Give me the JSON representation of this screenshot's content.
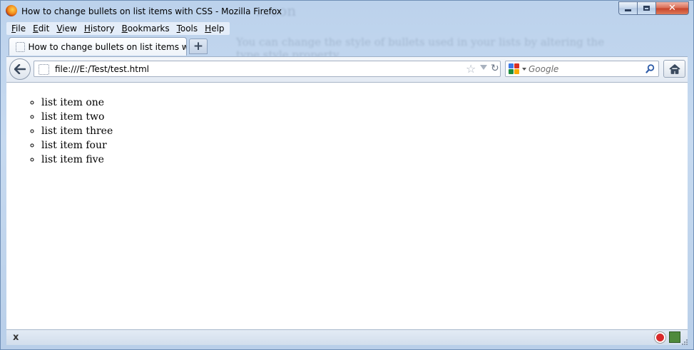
{
  "window": {
    "title": "How to change bullets on list items with CSS - Mozilla Firefox"
  },
  "background_ghost": {
    "heading": "…con",
    "line1": "You can change the style of bullets used in your lists by altering the",
    "line2": "type style property"
  },
  "menubar": {
    "items": [
      {
        "label": "File",
        "key": "F",
        "rest": "ile"
      },
      {
        "label": "Edit",
        "key": "E",
        "rest": "dit"
      },
      {
        "label": "View",
        "key": "V",
        "rest": "iew"
      },
      {
        "label": "History",
        "key": "H",
        "rest": "istory"
      },
      {
        "label": "Bookmarks",
        "key": "B",
        "rest": "ookmarks"
      },
      {
        "label": "Tools",
        "key": "T",
        "rest": "ools"
      },
      {
        "label": "Help",
        "key": "H",
        "rest": "elp"
      }
    ]
  },
  "tabs": [
    {
      "label": "How to change bullets on list items with...",
      "active": true
    }
  ],
  "navigation": {
    "url": "file:///E:/Test/test.html",
    "search_placeholder": "Google"
  },
  "page": {
    "list_items": [
      "list item one",
      "list item two",
      "list item three",
      "list item four",
      "list item five"
    ]
  },
  "status": {
    "close_glyph": "x"
  },
  "colors": {
    "frame": "#bcd2ec",
    "close_button": "#c7432a",
    "content_bg": "#ffffff"
  }
}
